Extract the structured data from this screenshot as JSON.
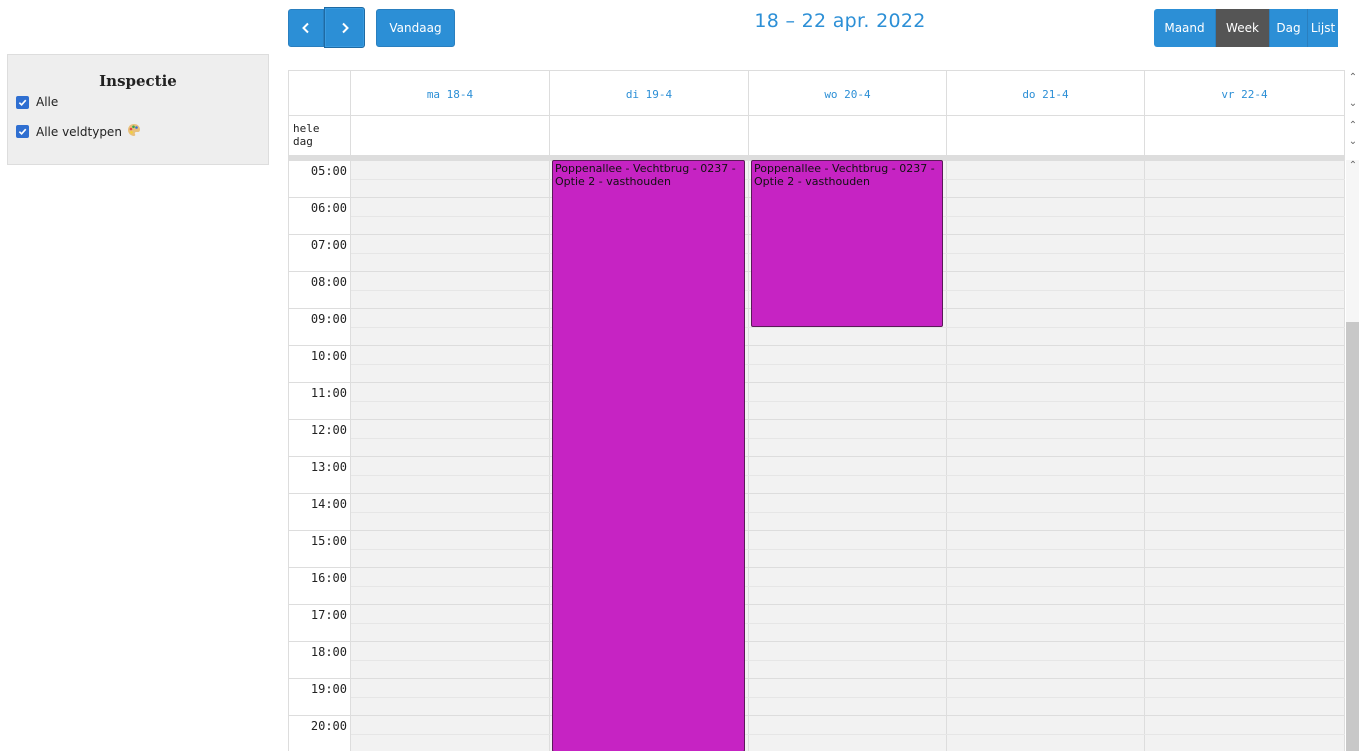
{
  "sidebar": {
    "title": "Inspectie",
    "filters": [
      {
        "label": "Alle",
        "checked": true
      },
      {
        "label": "Alle veldtypen",
        "checked": true
      }
    ],
    "palette_icon": "palette-icon"
  },
  "toolbar": {
    "prev_icon": "chevron-left-icon",
    "next_icon": "chevron-right-icon",
    "today_label": "Vandaag",
    "title": "18 – 22 apr. 2022",
    "views": [
      {
        "label": "Maand",
        "active": false
      },
      {
        "label": "Week",
        "active": true
      },
      {
        "label": "Dag",
        "active": false
      },
      {
        "label": "Lijst",
        "active": false
      }
    ]
  },
  "calendar": {
    "all_day_label": "hele dag",
    "days": [
      {
        "label": "ma 18-4"
      },
      {
        "label": "di 19-4"
      },
      {
        "label": "wo 20-4"
      },
      {
        "label": "do 21-4"
      },
      {
        "label": "vr 22-4"
      }
    ],
    "times": [
      "05:00",
      "06:00",
      "07:00",
      "08:00",
      "09:00",
      "10:00",
      "11:00",
      "12:00",
      "13:00",
      "14:00",
      "15:00",
      "16:00",
      "17:00",
      "18:00",
      "19:00",
      "20:00"
    ],
    "events": [
      {
        "day": 1,
        "start": "05:00",
        "end": "21:00",
        "title": "Poppenallee - Vechtbrug - 0237 - Optie 2 - vasthouden",
        "color": "#c623c3"
      },
      {
        "day": 2,
        "start": "05:00",
        "end": "09:30",
        "title": "Poppenallee - Vechtbrug - 0237 - Optie 2 - vasthouden",
        "color": "#c623c3"
      }
    ]
  },
  "colors": {
    "accent": "#2c8fd6",
    "active_view": "#555555",
    "slot_bg": "#f2f2f2",
    "event": "#c623c3"
  }
}
